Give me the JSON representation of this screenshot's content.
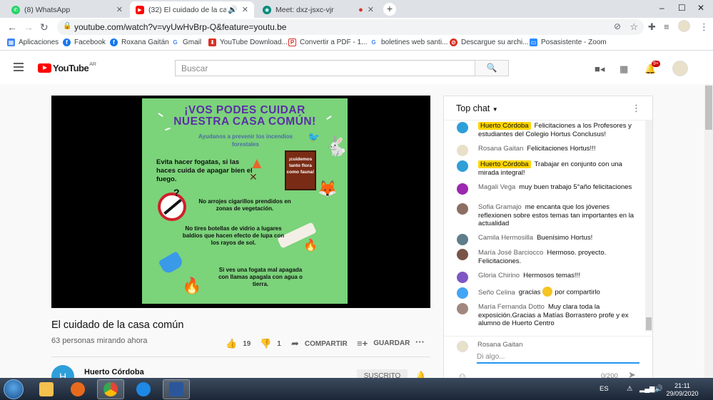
{
  "browser": {
    "tabs": [
      {
        "title": "(8) WhatsApp",
        "color": "#25d366"
      },
      {
        "title": "(32) El cuidado de la casa co",
        "color": "#ff0000"
      },
      {
        "title": "Meet: dxz-jsxc-vjr",
        "color": "#00897b"
      }
    ],
    "new_tab": "+",
    "window_controls": [
      "–",
      "☐",
      "✕"
    ],
    "url": "youtube.com/watch?v=vyUwHvBrp-Q&feature=youtu.be",
    "bookmarks": [
      {
        "label": "Aplicaciones",
        "color": "#ea4335",
        "glyph": "▦"
      },
      {
        "label": "Facebook",
        "color": "#1877f2",
        "glyph": "f"
      },
      {
        "label": "Roxana Gaitán",
        "color": "#1877f2",
        "glyph": "f"
      },
      {
        "label": "Gmail",
        "color": "#ffffff",
        "glyph": "G"
      },
      {
        "label": "YouTube Download...",
        "color": "#d93025",
        "glyph": "⬇"
      },
      {
        "label": "Convertir a PDF - 1...",
        "color": "#ffffff",
        "glyph": "P"
      },
      {
        "label": "boletines web santi...",
        "color": "#ffffff",
        "glyph": "G"
      },
      {
        "label": "Descargue su archi...",
        "color": "#d93025",
        "glyph": "⊘"
      },
      {
        "label": "Posasistente - Zoom",
        "color": "#2d8cff",
        "glyph": "▭"
      }
    ]
  },
  "youtube": {
    "logo_text": "YouTube",
    "logo_country": "AR",
    "search_placeholder": "Buscar",
    "notification_count": "9+"
  },
  "poster": {
    "title_line1": "¡VOS PODES CUIDAR",
    "title_line2": "NUESTRA CASA COMÚN!",
    "subtitle": "Ayudanos a prevenir los incendios forestales",
    "tip1": "Evita hacer fogatas, si las haces cuida de apagar bien el fuego.",
    "sign": "¡cuidemos tanto flora como fauna!",
    "tip2": "No arrojes cigarillos prendidos en zonas de vegetación.",
    "tip3": "No tires botellas de vidrio a lugares baldios que hacen efecto de lupa con los rayos de sol.",
    "tip4": "Si ves una fogata mal apagada con llamas apagala con agua o tierra."
  },
  "video": {
    "title": "El cuidado de la casa común",
    "viewers": "63 personas mirando ahora",
    "likes": "19",
    "dislikes": "1",
    "share_label": "COMPARTIR",
    "save_label": "GUARDAR",
    "more": "···",
    "channel_initial": "H",
    "channel_name": "Huerto Córdoba",
    "subscribed_label": "SUSCRITO"
  },
  "chat": {
    "header": "Top chat",
    "messages": [
      {
        "author": "Huerto Córdoba",
        "owner": true,
        "text": "Felicitaciones a los Profesores y estudiantes del Colegio Hortus Conclusus!",
        "avatar": "#2e9fd9"
      },
      {
        "author": "Rosana Gaitan",
        "owner": false,
        "text": "Felicitaciones Hortus!!!",
        "avatar": "#e8e0c8"
      },
      {
        "author": "Huerto Córdoba",
        "owner": true,
        "text": "Trabajar en conjunto con una mirada integral!",
        "avatar": "#2e9fd9"
      },
      {
        "author": "Magali Vega",
        "owner": false,
        "text": "muy buen trabajo 5°año felicitaciones",
        "avatar": "#9c27b0"
      },
      {
        "author": "Sofia Gramajo",
        "owner": false,
        "text": "me encanta que los jóvenes reflexionen sobre estos temas tan importantes en la actualidad",
        "avatar": "#8d6e63"
      },
      {
        "author": "Camila Hermosilla",
        "owner": false,
        "text": "Buenísimo Hortus!",
        "avatar": "#607d8b"
      },
      {
        "author": "María José Barciocco",
        "owner": false,
        "text": "Hermoso. proyecto. Felicitaciones.",
        "avatar": "#795548"
      },
      {
        "author": "Gloria Chirino",
        "owner": false,
        "text": "Hermosos temas!!!",
        "avatar": "#7e57c2"
      },
      {
        "author": "Seño Celina",
        "owner": false,
        "text_before": "gracias",
        "text_after": "por compartirlo",
        "avatar": "#42a5f5"
      },
      {
        "author": "María Fernanda Dotto",
        "owner": false,
        "text": "Muy clara toda la exposición.Gracias a Matías Borrastero profe y ex alumno de Huerto Centro",
        "avatar": "#a1887f"
      }
    ],
    "my_name": "Rosana Gaitan",
    "input_placeholder": "Di algo...",
    "char_count": "0/200"
  },
  "taskbar": {
    "language": "ES",
    "time": "21:11",
    "date": "29/09/2020"
  }
}
